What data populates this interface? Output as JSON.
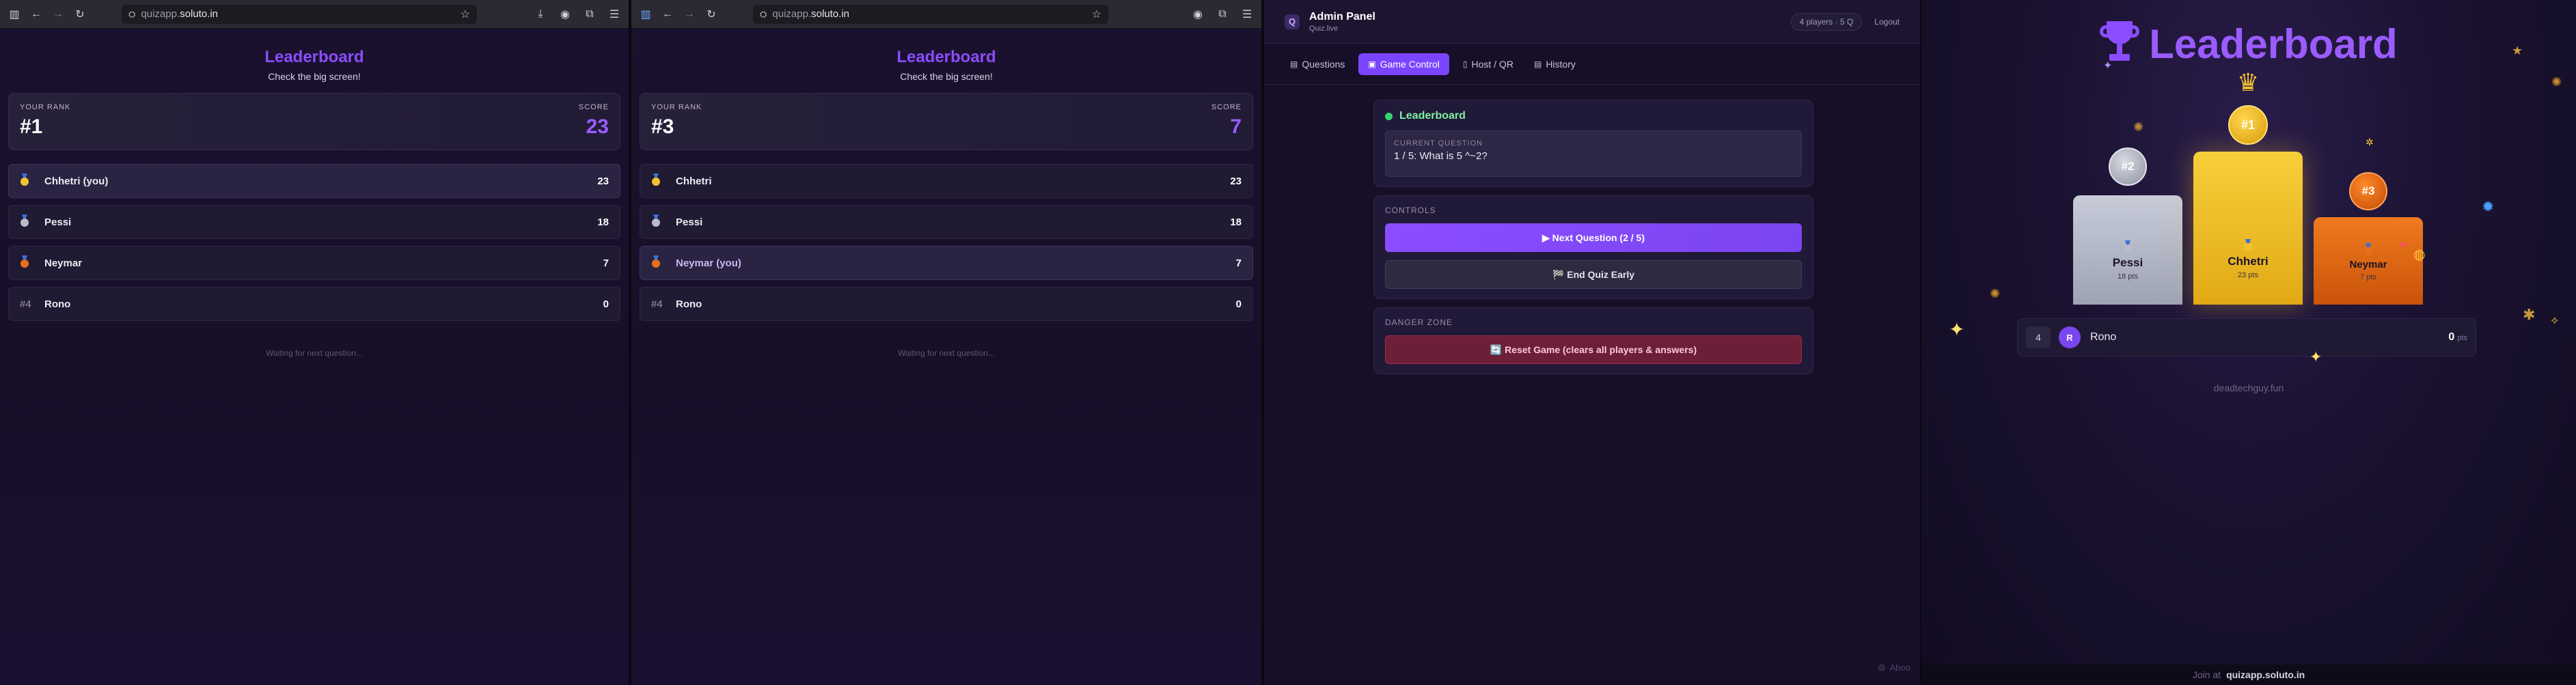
{
  "player1": {
    "url_prefix": "quizapp.",
    "url_domain": "soluto.in",
    "title": "Leaderboard",
    "subtitle": "Check the big screen!",
    "rank_label": "YOUR RANK",
    "rank_value": "#1",
    "score_label": "SCORE",
    "score_value": "23",
    "rows": [
      {
        "pos": "",
        "name": "Chhetri (you)",
        "score": "23",
        "medal": "gold"
      },
      {
        "pos": "",
        "name": "Pessi",
        "score": "18",
        "medal": "silver"
      },
      {
        "pos": "",
        "name": "Neymar",
        "score": "7",
        "medal": "bronze"
      },
      {
        "pos": "#4",
        "name": "Rono",
        "score": "0",
        "medal": ""
      }
    ],
    "waiting": "Waiting for next question..."
  },
  "player2": {
    "url_prefix": "quizapp.",
    "url_domain": "soluto.in",
    "title": "Leaderboard",
    "subtitle": "Check the big screen!",
    "rank_label": "YOUR RANK",
    "rank_value": "#3",
    "score_label": "SCORE",
    "score_value": "7",
    "rows": [
      {
        "pos": "",
        "name": "Chhetri",
        "score": "23",
        "medal": "gold"
      },
      {
        "pos": "",
        "name": "Pessi",
        "score": "18",
        "medal": "silver"
      },
      {
        "pos": "",
        "name": "Neymar (you)",
        "score": "7",
        "medal": "bronze"
      },
      {
        "pos": "#4",
        "name": "Rono",
        "score": "0",
        "medal": ""
      }
    ],
    "waiting": "Waiting for next question..."
  },
  "admin": {
    "title": "Admin Panel",
    "subtitle": "Quiz.live",
    "players_pill": "4 players · 5 Q",
    "logout": "Logout",
    "tabs": [
      {
        "icon": "▤",
        "label": "Questions"
      },
      {
        "icon": "▣",
        "label": "Game Control"
      },
      {
        "icon": "▯",
        "label": "Host / QR"
      },
      {
        "icon": "▤",
        "label": "History"
      }
    ],
    "status": "Leaderboard",
    "current_question_label": "CURRENT QUESTION",
    "current_question": "1 / 5: What is 5 ^~2?",
    "controls_label": "CONTROLS",
    "next_button": "▶ Next Question (2 / 5)",
    "end_button": "🏁 End Quiz Early",
    "danger_label": "DANGER ZONE",
    "reset_button": "🔄 Reset Game (clears all players & answers)",
    "corner_text": "Aboo"
  },
  "bigscreen": {
    "title": "Leaderboard",
    "podium": [
      {
        "rank": "#2",
        "name": "Pessi",
        "pts": "18 pts"
      },
      {
        "rank": "#1",
        "name": "Chhetri",
        "pts": "23 pts"
      },
      {
        "rank": "#3",
        "name": "Neymar",
        "pts": "7 pts"
      }
    ],
    "rest": {
      "pos": "4",
      "avatar": "R",
      "name": "Rono",
      "score": "0",
      "unit": "pts"
    },
    "host": "deadtechguy.fun",
    "join_label": "Join at",
    "join_url": "quizapp.soluto.in"
  },
  "colors": {
    "accent": "#8b4dff",
    "gold": "#f2c230",
    "silver": "#b8bccb",
    "bronze": "#e8701a",
    "success": "#35d46f",
    "danger": "#6e1f38"
  }
}
